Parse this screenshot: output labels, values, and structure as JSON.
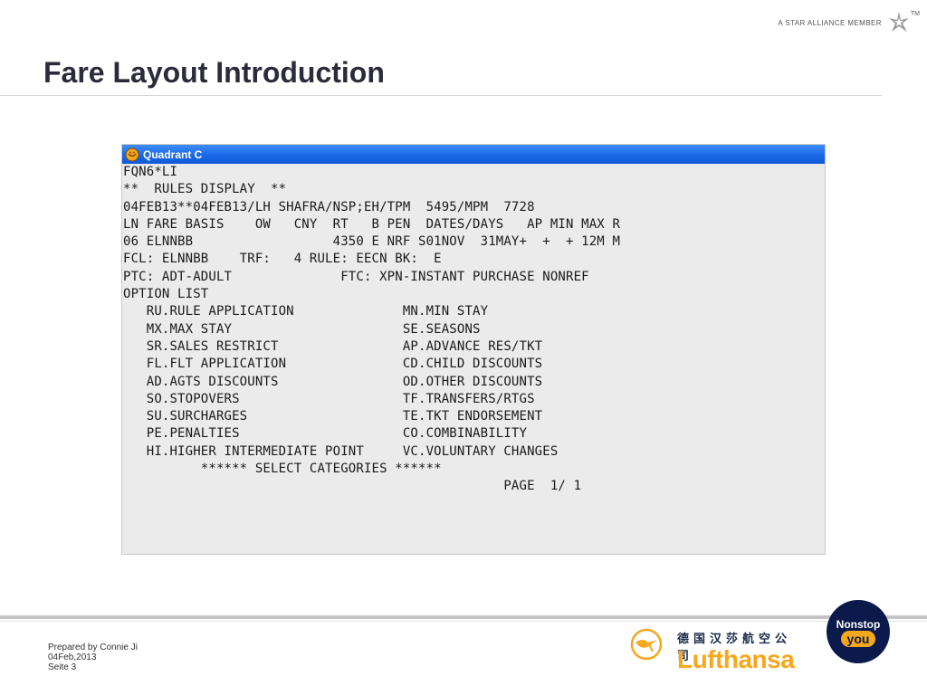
{
  "header": {
    "alliance_text": "A STAR ALLIANCE MEMBER",
    "alliance_tm": "TM"
  },
  "slide": {
    "title": "Fare Layout Introduction"
  },
  "terminal": {
    "window_title": "Quadrant C",
    "lines": [
      "FQN6*LI",
      "**  RULES DISPLAY  **",
      "04FEB13**04FEB13/LH SHAFRA/NSP;EH/TPM  5495/MPM  7728",
      "LN FARE BASIS    OW   CNY  RT   B PEN  DATES/DAYS   AP MIN MAX R",
      "06 ELNNBB                  4350 E NRF S01NOV  31MAY+  +  + 12M M",
      "FCL: ELNNBB    TRF:   4 RULE: EECN BK:  E",
      "PTC: ADT-ADULT              FTC: XPN-INSTANT PURCHASE NONREF",
      "OPTION LIST",
      "   RU.RULE APPLICATION              MN.MIN STAY",
      "   MX.MAX STAY                      SE.SEASONS",
      "   SR.SALES RESTRICT                AP.ADVANCE RES/TKT",
      "   FL.FLT APPLICATION               CD.CHILD DISCOUNTS",
      "   AD.AGTS DISCOUNTS                OD.OTHER DISCOUNTS",
      "   SO.STOPOVERS                     TF.TRANSFERS/RTGS",
      "   SU.SURCHARGES                    TE.TKT ENDORSEMENT",
      "   PE.PENALTIES                     CO.COMBINABILITY",
      "   HI.HIGHER INTERMEDIATE POINT     VC.VOLUNTARY CHANGES",
      "          ****** SELECT CATEGORIES ******",
      "                                                 PAGE  1/ 1"
    ]
  },
  "footer": {
    "prepared_by": "Prepared by Connie Ji",
    "date": "04Feb,2013",
    "page": "Seite 3"
  },
  "brand": {
    "chinese_name": "德国汉莎航空公司",
    "name": "Lufthansa",
    "accent_color": "#f5a81c",
    "navy_color": "#0b1a4a",
    "nonstop_top": "Nonstop",
    "nonstop_you": "you"
  }
}
